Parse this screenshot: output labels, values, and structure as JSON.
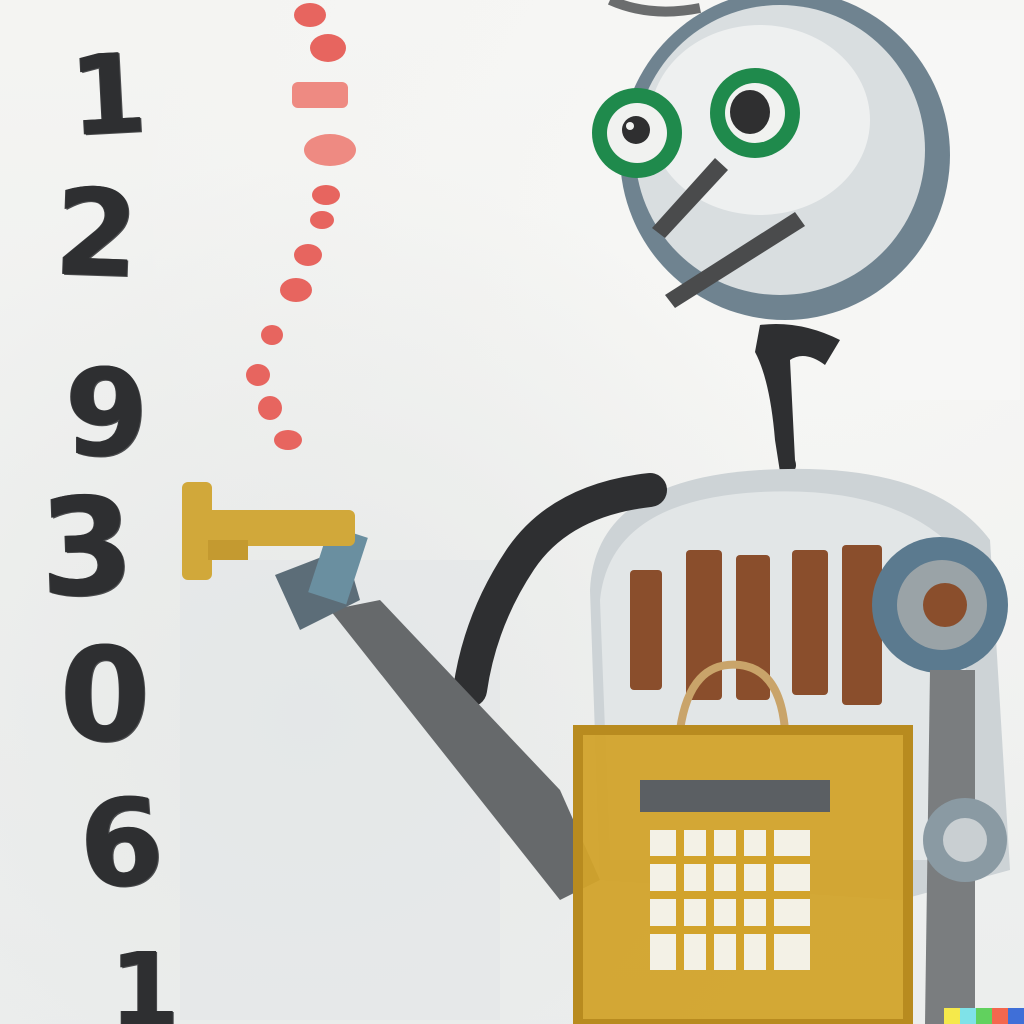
{
  "scene": {
    "subject": "robot",
    "held_object": "key",
    "carried_object": "basket"
  },
  "digits": [
    "1",
    "2",
    "9",
    "3",
    "0",
    "6",
    "1"
  ],
  "colors": {
    "background": "#f1f2f0",
    "robot_grey": "#6b6d6e",
    "robot_light": "#d6dadb",
    "eye_green": "#1f8a4c",
    "basket_yellow": "#d2a32b",
    "key_yellow": "#d1a83a",
    "stripe_brown": "#8a4e2c",
    "dots_red": "#e7655f"
  },
  "signature_colors": [
    "#f5e94b",
    "#7fe2e8",
    "#61d15e",
    "#f4674e",
    "#3f6fd8"
  ]
}
